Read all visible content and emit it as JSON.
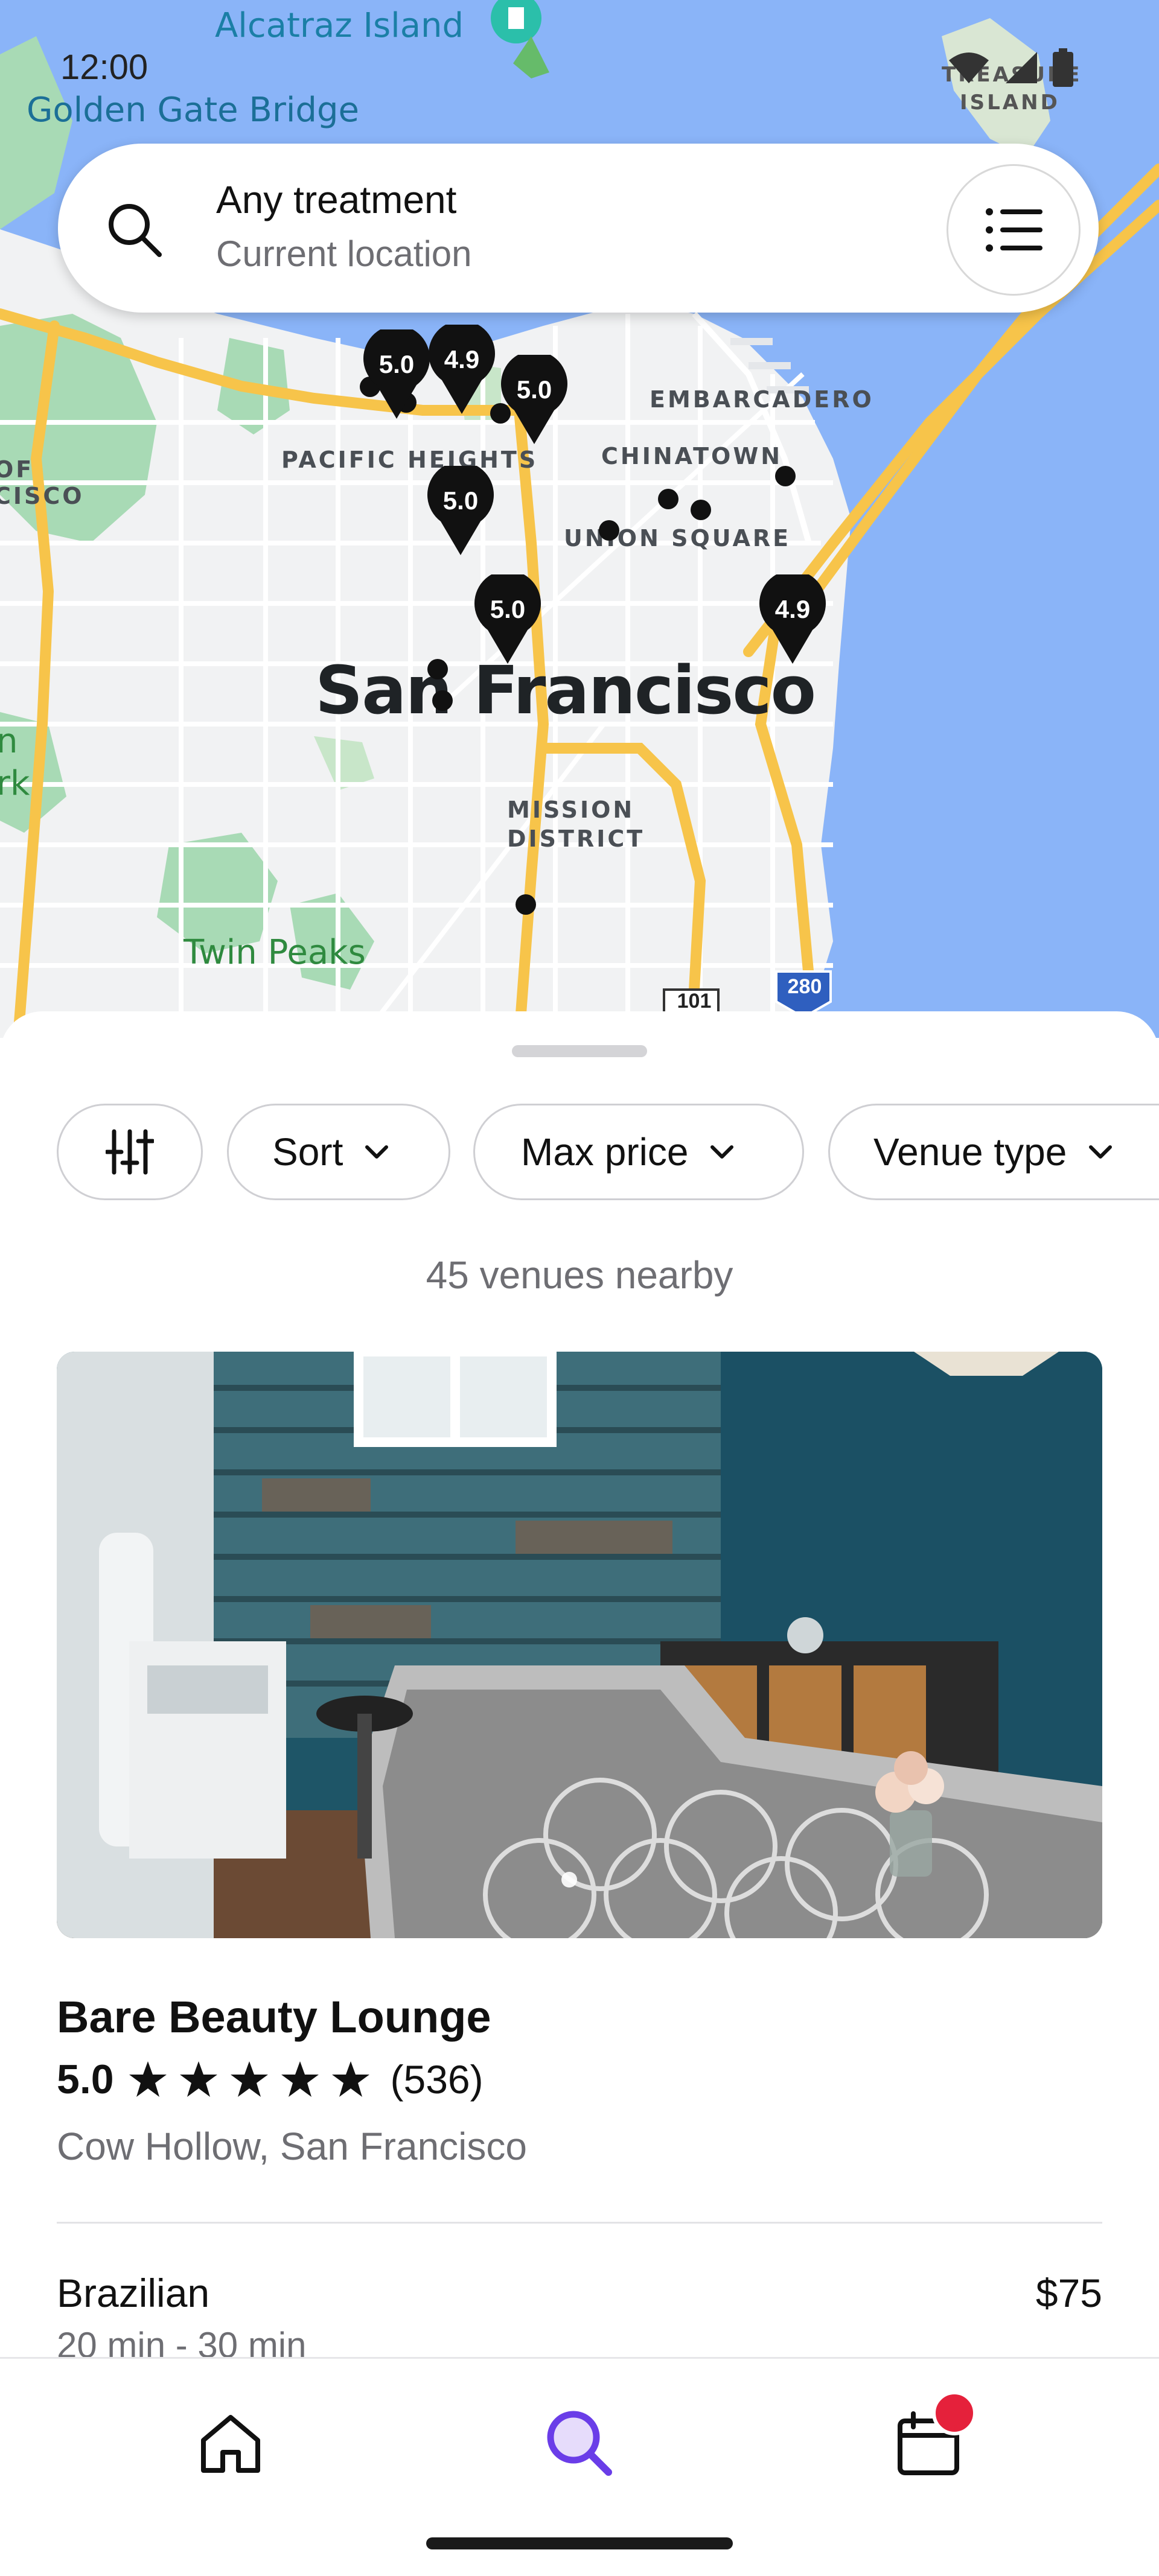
{
  "status_bar": {
    "time": "12:00"
  },
  "map": {
    "labels": {
      "alcatraz": "Alcatraz Island",
      "golden_gate": "Golden Gate Bridge",
      "treasure_island_1": "TREASURE",
      "treasure_island_2": "ISLAND",
      "embarcadero": "EMBARCADERO",
      "pacific_heights": "PACIFIC HEIGHTS",
      "chinatown": "CHINATOWN",
      "union_square": "UNION SQUARE",
      "presidio_1": "OF",
      "presidio_2": "CISCO",
      "city": "San Francisco",
      "mission_1": "MISSION",
      "mission_2": "DISTRICT",
      "twin_peaks": "Twin Peaks",
      "park_fragment": "rk",
      "park_fragment_2": "n",
      "hwy_101": "101",
      "hwy_280": "280"
    },
    "pins": [
      "5.0",
      "4.9",
      "5.0",
      "5.0",
      "5.0",
      "4.9"
    ]
  },
  "search": {
    "title": "Any treatment",
    "subtitle": "Current location"
  },
  "filters": {
    "sort": "Sort",
    "max_price": "Max price",
    "venue_type": "Venue type"
  },
  "results": {
    "count_text": "45 venues nearby"
  },
  "venue": {
    "name": "Bare Beauty Lounge",
    "rating": "5.0",
    "stars": 5,
    "reviews": "(536)",
    "location": "Cow Hollow, San Francisco",
    "service": {
      "name": "Brazilian",
      "price": "$75",
      "duration": "20 min - 30 min"
    }
  },
  "colors": {
    "accent": "#6a3de8",
    "badge": "#e5213b",
    "water": "#8ab4f8",
    "park": "#a8dab5",
    "highway": "#f7c44a"
  }
}
